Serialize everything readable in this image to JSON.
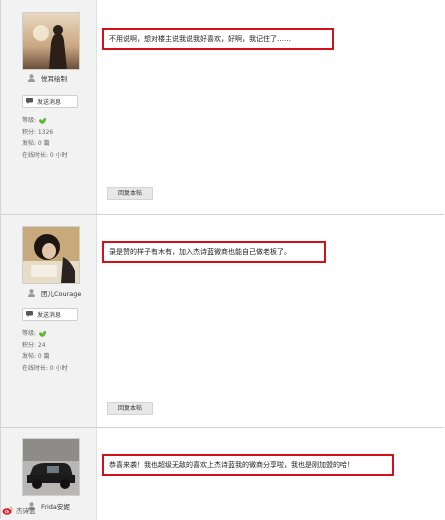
{
  "posts": [
    {
      "username": "悦耳绘制",
      "send_message": "发送消息",
      "stats": [
        "等级:",
        "积分: 1326",
        "发帖: 0 篇",
        "在线时长: 0 小时"
      ],
      "message": "不用说啊，想对楼主说我说我好喜欢，好啊，我记住了……",
      "reply": "回复本帖"
    },
    {
      "username": "团儿Courage",
      "send_message": "发送消息",
      "stats": [
        "等级:",
        "积分: 24",
        "发帖: 0 篇",
        "在线时长: 0 小时"
      ],
      "message": "录是赞的样子有木有，加入杰诗蓝微商也能自己做老板了。",
      "reply": "回复本帖"
    },
    {
      "username": "Frida安妮",
      "message": "恭喜来袭！我也超级无敌的喜欢上杰诗蓝我的微商分享啦，我也是刚加盟的哈！"
    }
  ],
  "watermark": "杰诗蓝",
  "colors": {
    "highlight_border": "#d4101b",
    "sidebar_bg": "#f2f2f2",
    "level_icon": "#5cb82f"
  }
}
